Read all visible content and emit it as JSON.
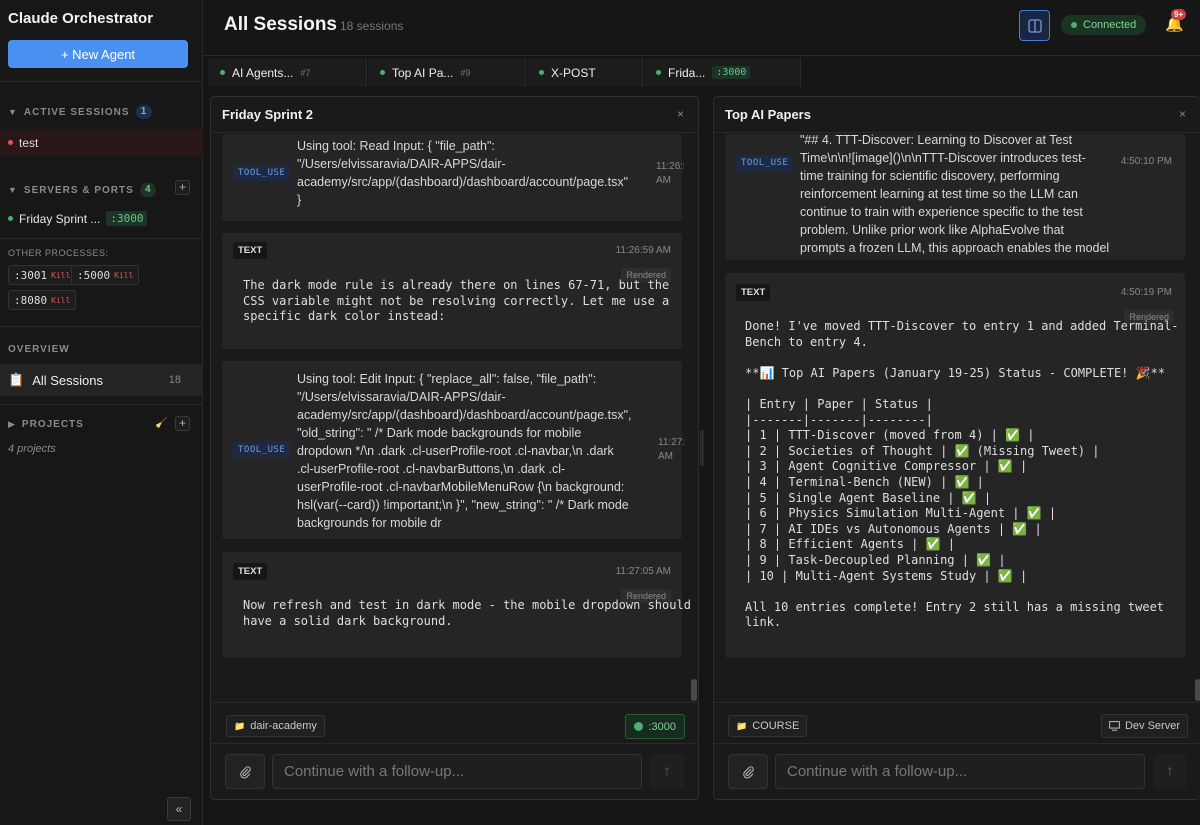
{
  "sidebar": {
    "app_title": "Claude Orchestrator",
    "new_agent_label": "+ New Agent",
    "active_sessions": {
      "label": "ACTIVE SESSIONS",
      "count": "1",
      "items": [
        {
          "label": "test"
        }
      ]
    },
    "servers": {
      "label": "SERVERS & PORTS",
      "count": "4",
      "add": "+",
      "items": [
        {
          "label": "Friday Sprint ...",
          "port": ":3000"
        }
      ]
    },
    "other_processes": {
      "label": "OTHER PROCESSES:",
      "items": [
        {
          "port": ":3001",
          "kill": "Kill"
        },
        {
          "port": ":5000",
          "kill": "Kill"
        },
        {
          "port": ":8080",
          "kill": "Kill"
        }
      ]
    },
    "overview": {
      "label": "OVERVIEW",
      "all_sessions_label": "All Sessions",
      "all_sessions_count": "18"
    },
    "projects": {
      "label": "PROJECTS",
      "add": "+",
      "subtitle": "4 projects"
    },
    "collapse": "«"
  },
  "header": {
    "title": "All Sessions",
    "subtitle": "18 sessions",
    "status": "Connected",
    "notifications": "9+"
  },
  "tabs": [
    {
      "label": "AI Agents...",
      "num": "#7",
      "dot": "#4caf6e"
    },
    {
      "label": "Top AI Pa...",
      "num": "#9",
      "dot": "#4caf6e"
    },
    {
      "label": "X-POST",
      "num": "",
      "dot": "#4caf6e"
    },
    {
      "label": "Frida...",
      "num": "",
      "port": ":3000",
      "dot": "#4caf6e"
    }
  ],
  "panels": {
    "left": {
      "title": "Friday Sprint 2",
      "close": "×",
      "cards": [
        {
          "type": "TOOL_USE",
          "time": "11:26:55 AM",
          "lines": [
            "Using tool: Read Input: { \"file_path\":",
            "\"/Users/elvissaravia/DAIR-APPS/dair-",
            "academy/src/app/(dashboard)/dashboard/account/page.tsx\"",
            "}"
          ]
        },
        {
          "type": "TEXT",
          "time": "11:26:59 AM",
          "rendered": "Rendered",
          "text": "The dark mode rule is already there on lines 67-71, but the\nCSS variable might not be resolving correctly. Let me use a\nspecific dark color instead:"
        },
        {
          "type": "TOOL_USE",
          "time": "11:27:02 AM",
          "lines": [
            "Using tool: Edit Input: { \"replace_all\": false, \"file_path\":",
            "\"/Users/elvissaravia/DAIR-APPS/dair-",
            "academy/src/app/(dashboard)/dashboard/account/page.tsx\",",
            "\"old_string\": \" /* Dark mode backgrounds for mobile",
            "dropdown */\\n .dark .cl-userProfile-root .cl-navbar,\\n .dark",
            ".cl-userProfile-root .cl-navbarButtons,\\n .dark .cl-",
            "userProfile-root .cl-navbarMobileMenuRow {\\n background:",
            "hsl(var(--card)) !important;\\n }\", \"new_string\": \" /* Dark mode",
            "backgrounds for mobile dr"
          ]
        },
        {
          "type": "TEXT",
          "time": "11:27:05 AM",
          "rendered": "Rendered",
          "text": "Now refresh and test in dark mode - the mobile dropdown should\nhave a solid dark background."
        }
      ],
      "project_chip": "dair-academy",
      "port_button": ":3000",
      "input_placeholder": "Continue with a follow-up..."
    },
    "right": {
      "title": "Top AI Papers",
      "close": "×",
      "cards": [
        {
          "type": "TOOL_USE",
          "time": "4:50:10 PM",
          "lines": [
            "\"## 4. TTT-Discover: Learning to Discover at Test",
            "Time\\n\\n![image]()\\n\\nTTT-Discover introduces test-",
            "time training for scientific discovery, performing",
            "reinforcement learning at test time so the LLM can",
            "continue to train with experience specific to the test",
            "problem. Unlike prior work like AlphaEvolve that",
            "prompts a frozen LLM, this approach enables the model"
          ]
        },
        {
          "type": "TEXT",
          "time": "4:50:19 PM",
          "rendered": "Rendered",
          "text": "Done! I've moved TTT-Discover to entry 1 and added Terminal-\nBench to entry 4.\n\n**📊 Top AI Papers (January 19-25) Status - COMPLETE! 🎉**\n\n| Entry | Paper | Status |\n|-------|-------|--------|\n| 1 | TTT-Discover (moved from 4) | ✅ |\n| 2 | Societies of Thought | ✅ (Missing Tweet) |\n| 3 | Agent Cognitive Compressor | ✅ |\n| 4 | Terminal-Bench (NEW) | ✅ |\n| 5 | Single Agent Baseline | ✅ |\n| 6 | Physics Simulation Multi-Agent | ✅ |\n| 7 | AI IDEs vs Autonomous Agents | ✅ |\n| 8 | Efficient Agents | ✅ |\n| 9 | Task-Decoupled Planning | ✅ |\n| 10 | Multi-Agent Systems Study | ✅ |\n\nAll 10 entries complete! Entry 2 still has a missing tweet\nlink."
        }
      ],
      "project_chip": "COURSE",
      "dev_server_button": "Dev Server",
      "input_placeholder": "Continue with a follow-up..."
    }
  },
  "colors": {
    "accent": "#4a90f0",
    "success": "#4caf6e",
    "danger": "#e05555",
    "tool_badge": "#6f9be6"
  },
  "icons": {
    "layout": "split-view-icon",
    "bell": "bell-icon",
    "attach": "paperclip-icon",
    "send": "arrow-up-icon",
    "folder": "folder-icon",
    "monitor": "monitor-icon",
    "clipboard": "clipboard-icon",
    "broom": "broom-icon"
  }
}
